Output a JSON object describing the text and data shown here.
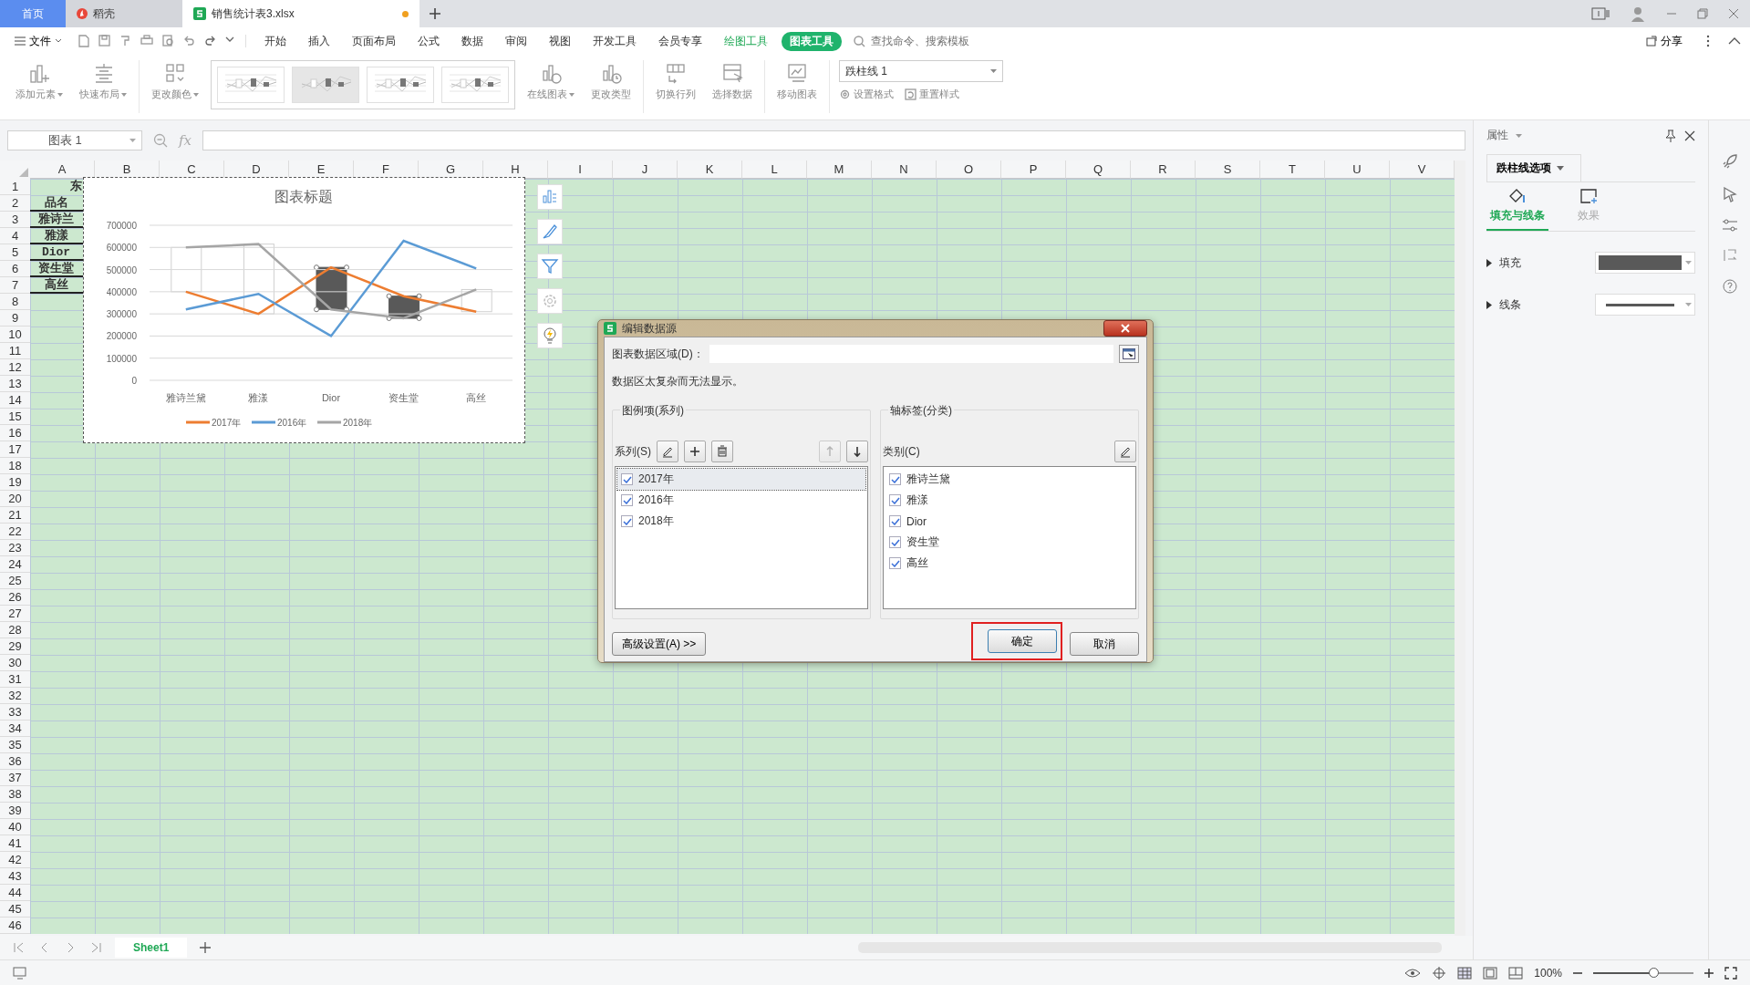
{
  "tabs": [
    {
      "label": "首页",
      "kind": "home",
      "selected": false,
      "unsaved": false
    },
    {
      "label": "稻壳",
      "kind": "docer",
      "selected": false,
      "unsaved": false
    },
    {
      "label": "销售统计表3.xlsx",
      "kind": "sheet",
      "selected": true,
      "unsaved": true
    }
  ],
  "menu": {
    "file": "文件",
    "items": [
      {
        "label": "开始",
        "kind": "plain",
        "selected": false
      },
      {
        "label": "插入",
        "kind": "plain",
        "selected": false
      },
      {
        "label": "页面布局",
        "kind": "plain",
        "selected": false
      },
      {
        "label": "公式",
        "kind": "plain",
        "selected": false
      },
      {
        "label": "数据",
        "kind": "plain",
        "selected": false
      },
      {
        "label": "审阅",
        "kind": "plain",
        "selected": false
      },
      {
        "label": "视图",
        "kind": "plain",
        "selected": false
      },
      {
        "label": "开发工具",
        "kind": "plain",
        "selected": false
      },
      {
        "label": "会员专享",
        "kind": "plain",
        "selected": false
      },
      {
        "label": "绘图工具",
        "kind": "context",
        "selected": false
      },
      {
        "label": "图表工具",
        "kind": "context",
        "selected": true
      }
    ],
    "search": {
      "placeholder": "查找命令、搜索模板"
    },
    "share": "分享"
  },
  "ribbon": {
    "tools": [
      {
        "label": "添加元素",
        "kind": "add",
        "dropdown": true
      },
      {
        "label": "快速布局",
        "kind": "layout",
        "dropdown": true
      },
      {
        "label": "更改颜色",
        "kind": "color",
        "dropdown": true
      },
      {
        "kind": "gallery"
      },
      {
        "label": "在线图表",
        "kind": "online",
        "dropdown": true
      },
      {
        "label": "更改类型",
        "kind": "type",
        "dropdown": false
      },
      {
        "label": "切换行列",
        "kind": "switch",
        "dropdown": false
      },
      {
        "label": "选择数据",
        "kind": "select",
        "dropdown": false
      },
      {
        "label": "移动图表",
        "kind": "move",
        "dropdown": false
      }
    ],
    "styles": [
      {
        "selected": false
      },
      {
        "selected": true
      },
      {
        "selected": false
      },
      {
        "selected": false
      }
    ],
    "element_select": {
      "value": "跌柱线 1"
    },
    "small_tools": [
      {
        "label": "设置格式",
        "kind": "format"
      },
      {
        "label": "重置样式",
        "kind": "reset"
      }
    ]
  },
  "formula_bar": {
    "name_box": "图表 1",
    "fx": "fx"
  },
  "sheet": {
    "columns": [
      "A",
      "B",
      "C",
      "D",
      "E",
      "F",
      "G",
      "H",
      "I",
      "J",
      "K",
      "L",
      "M",
      "N",
      "O",
      "P",
      "Q",
      "R",
      "S",
      "T",
      "U",
      "V"
    ],
    "rows": [
      "1",
      "2",
      "3",
      "4",
      "5",
      "6",
      "7",
      "8",
      "9",
      "10",
      "11",
      "12",
      "13",
      "14",
      "15",
      "16",
      "17",
      "18",
      "19",
      "20",
      "21",
      "22",
      "23",
      "24",
      "25",
      "26",
      "27",
      "28",
      "29",
      "30",
      "31",
      "32",
      "33",
      "34",
      "35",
      "36",
      "37",
      "38",
      "39",
      "40",
      "41",
      "42",
      "43",
      "44",
      "45",
      "46"
    ],
    "cells": [
      "东",
      "品名",
      "雅诗兰",
      "雅漾",
      "Dior",
      "资生堂",
      "高丝"
    ]
  },
  "chart": {
    "up_down_bars": true,
    "down_bars_selected": true,
    "chart_data": {
      "type": "line",
      "title": "图表标题",
      "categories": [
        "雅诗兰黛",
        "雅漾",
        "Dior",
        "资生堂",
        "高丝"
      ],
      "series": [
        {
          "name": "2017年",
          "color": "#ed7d31",
          "values": [
            400000,
            300000,
            510000,
            380000,
            310000
          ]
        },
        {
          "name": "2016年",
          "color": "#5b9bd5",
          "values": [
            320000,
            390000,
            200000,
            630000,
            505000
          ]
        },
        {
          "name": "2018年",
          "color": "#a5a5a5",
          "values": [
            600000,
            615000,
            320000,
            280000,
            410000
          ]
        }
      ],
      "grid": true,
      "legend": true,
      "ylim": [
        0,
        700000
      ],
      "yticks": [
        0,
        100000,
        200000,
        300000,
        400000,
        500000,
        600000,
        700000
      ]
    }
  },
  "dialog": {
    "title": "编辑数据源",
    "range_label": "图表数据区域(D)：",
    "message": "数据区太复杂而无法显示。",
    "series_group": {
      "title": "图例项(系列)",
      "label": "系列(S)",
      "items": [
        {
          "label": "2017年",
          "checked": true,
          "selected": true
        },
        {
          "label": "2016年",
          "checked": true,
          "selected": false
        },
        {
          "label": "2018年",
          "checked": true,
          "selected": false
        }
      ]
    },
    "category_group": {
      "title": "轴标签(分类)",
      "label": "类别(C)",
      "items": [
        {
          "label": "雅诗兰黛",
          "checked": true
        },
        {
          "label": "雅漾",
          "checked": true
        },
        {
          "label": "Dior",
          "checked": true
        },
        {
          "label": "资生堂",
          "checked": true
        },
        {
          "label": "高丝",
          "checked": true
        }
      ]
    },
    "advanced": "高级设置(A) >>",
    "ok": {
      "label": "确定",
      "highlighted": true
    },
    "cancel": "取消"
  },
  "properties_panel": {
    "title": "属性",
    "dropdown": "跌柱线选项",
    "tabs": [
      {
        "label": "填充与线条",
        "kind": "fill",
        "selected": true
      },
      {
        "label": "效果",
        "kind": "effect",
        "selected": false
      }
    ],
    "sections": [
      {
        "label": "填充",
        "kind": "fill"
      },
      {
        "label": "线条",
        "kind": "line"
      }
    ]
  },
  "sheet_tabs": [
    {
      "label": "Sheet1",
      "selected": true
    }
  ],
  "status_bar": {
    "zoom": "100%",
    "level": 0.6
  }
}
